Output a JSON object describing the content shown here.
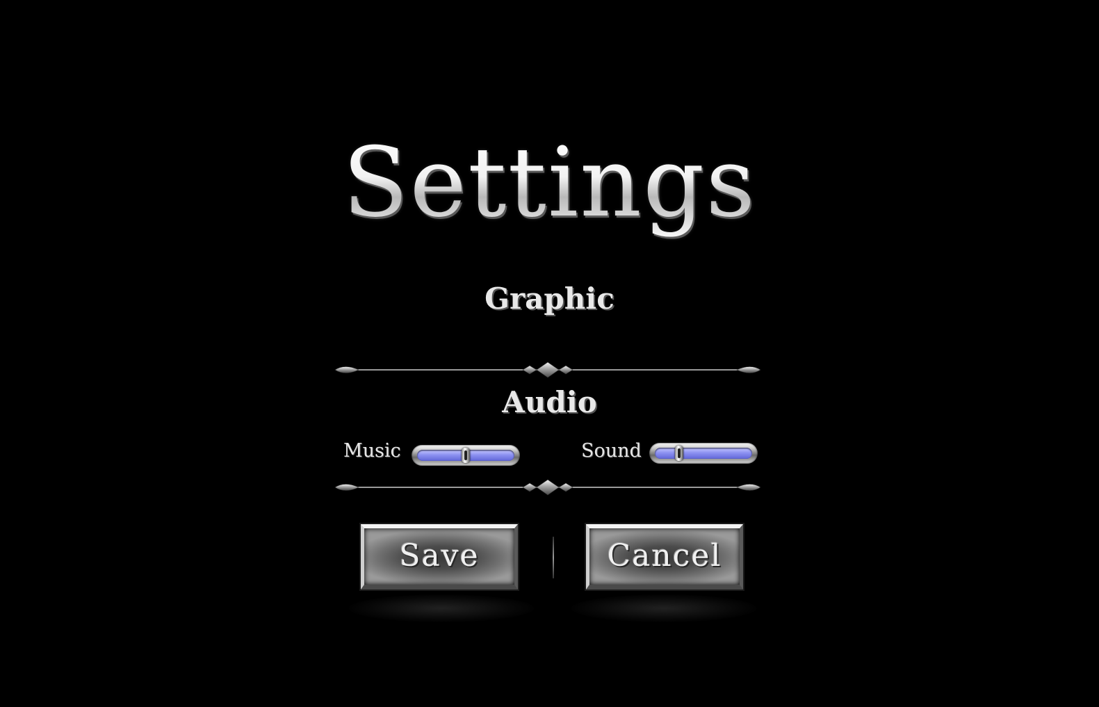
{
  "title": "Settings",
  "sections": {
    "graphic": {
      "heading": "Graphic"
    },
    "audio": {
      "heading": "Audio",
      "music": {
        "label": "Music",
        "level": 0.5
      },
      "sound": {
        "label": "Sound",
        "level": 0.25
      }
    }
  },
  "buttons": {
    "save": "Save",
    "cancel": "Cancel"
  },
  "colors": {
    "background": "#000000",
    "text": "#eeeeee",
    "slider_fill": "#8e93f2"
  },
  "icons": {
    "divider": "ornamental-divider-icon",
    "thumb": "slider-thumb"
  }
}
